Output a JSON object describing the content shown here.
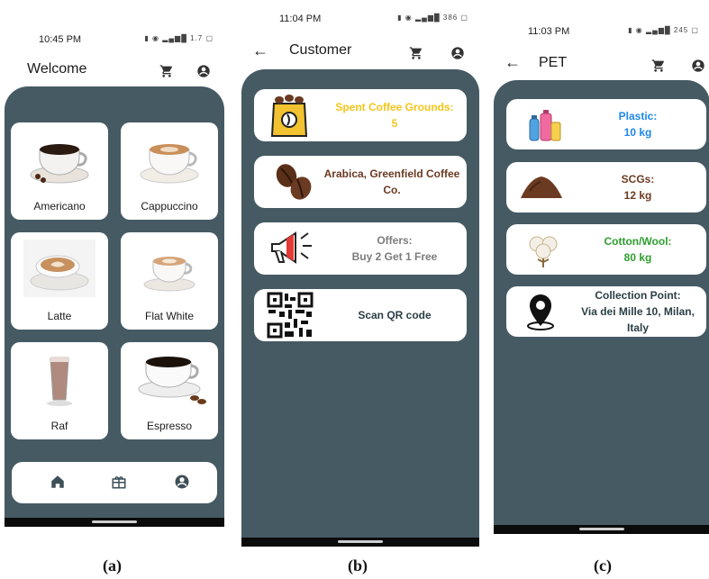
{
  "colors": {
    "panel": "#465a63",
    "yellow": "#f5c518",
    "brown": "#6b3a22",
    "gray": "#7c7c7c",
    "dark": "#2c3e46",
    "blue": "#1e88e5",
    "green": "#2e9e2e"
  },
  "screen_a": {
    "time": "10:45 PM",
    "status_icons": "▮ ◉ ▂▄▆█ 1.7 ▢",
    "title": "Welcome",
    "products": [
      {
        "label": "Americano",
        "icon": "coffee-cup-icon"
      },
      {
        "label": "Cappuccino",
        "icon": "cappuccino-icon"
      },
      {
        "label": "Latte",
        "icon": "latte-art-icon"
      },
      {
        "label": "Flat White",
        "icon": "flat-white-icon"
      },
      {
        "label": "Raf",
        "icon": "tall-glass-icon"
      },
      {
        "label": "Espresso",
        "icon": "espresso-icon"
      }
    ],
    "bottom_nav": [
      "home-icon",
      "gift-icon",
      "account-icon"
    ],
    "caption": "(a)"
  },
  "screen_b": {
    "time": "11:04 PM",
    "status_icons": "▮ ◉ ▂▄▆█ 386 ▢",
    "title": "Customer",
    "cards": [
      {
        "line1": "Spent Coffee Grounds:",
        "line2": "5",
        "icon": "coffee-bag-icon"
      },
      {
        "line1": "Arabica, Greenfield Coffee",
        "line2": "Co.",
        "icon": "coffee-beans-icon"
      },
      {
        "line1": "Offers:",
        "line2": "Buy 2 Get 1 Free",
        "icon": "megaphone-icon"
      },
      {
        "line1": "Scan QR code",
        "line2": "",
        "icon": "qr-code-icon"
      }
    ],
    "caption": "(b)"
  },
  "screen_c": {
    "time": "11:03 PM",
    "status_icons": "▮ ◉ ▂▄▆█ 245 ▢",
    "title": "PET",
    "cards": [
      {
        "line1": "Plastic:",
        "line2": "10 kg",
        "icon": "plastic-bottles-icon"
      },
      {
        "line1": "SCGs:",
        "line2": "12 kg",
        "icon": "coffee-grounds-pile-icon"
      },
      {
        "line1": "Cotton/Wool:",
        "line2": "80 kg",
        "icon": "cotton-icon"
      },
      {
        "line1": "Collection Point:",
        "line2": "Via dei Mille 10, Milan,",
        "line3": "Italy",
        "icon": "map-pin-icon"
      }
    ],
    "caption": "(c)"
  }
}
